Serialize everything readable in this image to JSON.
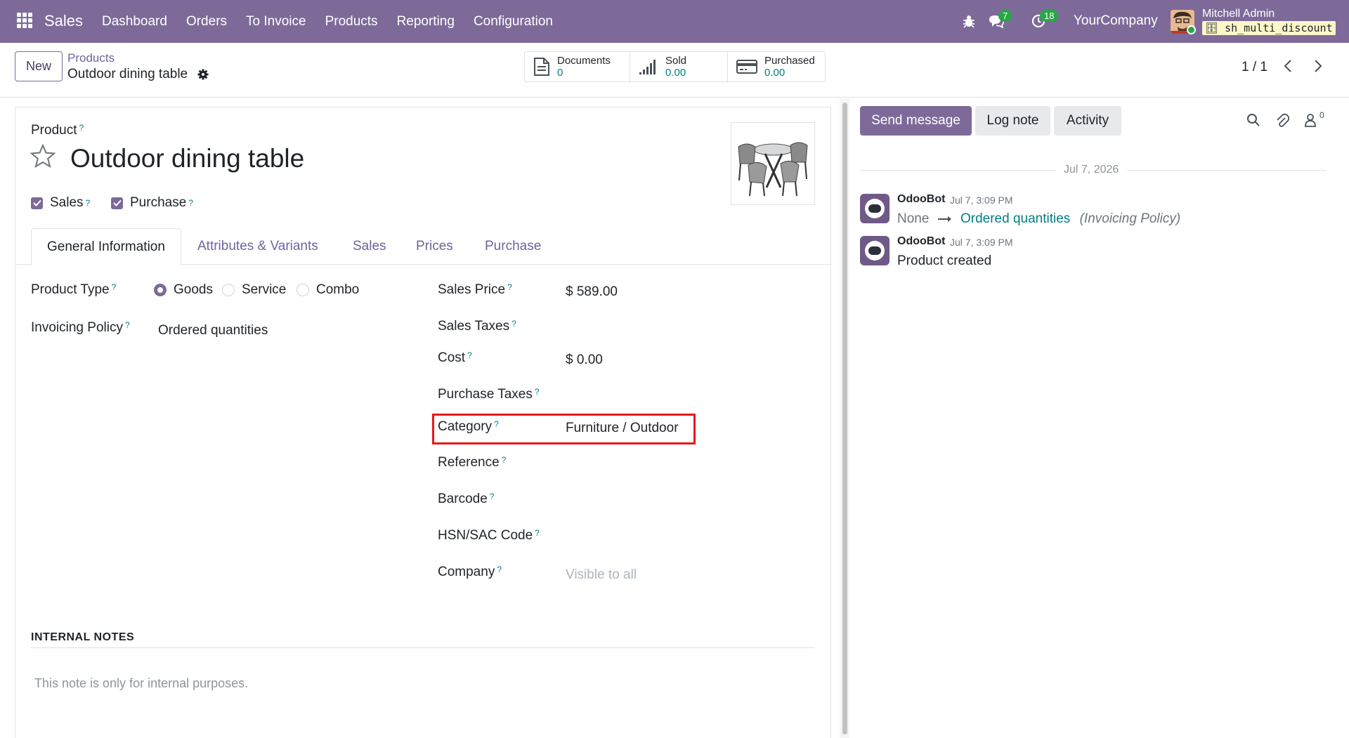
{
  "navbar": {
    "app_name": "Sales",
    "menu": [
      "Dashboard",
      "Orders",
      "To Invoice",
      "Products",
      "Reporting",
      "Configuration"
    ],
    "messages_count": "7",
    "activities_count": "18",
    "company": "YourCompany",
    "user_name": "Mitchell Admin",
    "db_name": "sh_multi_discount"
  },
  "control_panel": {
    "new_label": "New",
    "breadcrumb_parent": "Products",
    "breadcrumb_current": "Outdoor dining table",
    "smart_buttons": [
      {
        "label": "Documents",
        "value": "0",
        "icon": "document-icon"
      },
      {
        "label": "Sold",
        "value": "0.00",
        "icon": "bar-chart-icon"
      },
      {
        "label": "Purchased",
        "value": "0.00",
        "icon": "credit-card-icon"
      }
    ],
    "pager": "1 / 1"
  },
  "form": {
    "product_label": "Product",
    "product_name": "Outdoor dining table",
    "help_mark": "?",
    "sales_check": "Sales",
    "purchase_check": "Purchase",
    "tabs": [
      "General Information",
      "Attributes & Variants",
      "Sales",
      "Prices",
      "Purchase"
    ],
    "active_tab": "General Information",
    "left_fields": {
      "product_type_label": "Product Type",
      "product_type_options": [
        "Goods",
        "Service",
        "Combo"
      ],
      "product_type_selected": "Goods",
      "invoicing_policy_label": "Invoicing Policy",
      "invoicing_policy_value": "Ordered quantities"
    },
    "right_fields": {
      "sales_price_label": "Sales Price",
      "sales_price_value": "$ 589.00",
      "sales_taxes_label": "Sales Taxes",
      "cost_label": "Cost",
      "cost_value": "$ 0.00",
      "purchase_taxes_label": "Purchase Taxes",
      "category_label": "Category",
      "category_value": "Furniture / Outdoor",
      "reference_label": "Reference",
      "barcode_label": "Barcode",
      "hsn_label": "HSN/SAC Code",
      "company_label": "Company",
      "company_placeholder": "Visible to all"
    },
    "internal_notes_title": "INTERNAL NOTES",
    "internal_notes_placeholder": "This note is only for internal purposes."
  },
  "chatter": {
    "send_message": "Send message",
    "log_note": "Log note",
    "activity": "Activity",
    "followers_count": "0",
    "date_separator": "Jul 7, 2026",
    "messages": [
      {
        "author": "OdooBot",
        "date": "Jul 7, 3:09 PM",
        "old_value": "None",
        "new_value": "Ordered quantities",
        "field": "(Invoicing Policy)"
      },
      {
        "author": "OdooBot",
        "date": "Jul 7, 3:09 PM",
        "body": "Product created"
      }
    ]
  },
  "colors": {
    "brand": "#7d6a99",
    "link": "#017e84",
    "highlight": "#e41a1c"
  }
}
